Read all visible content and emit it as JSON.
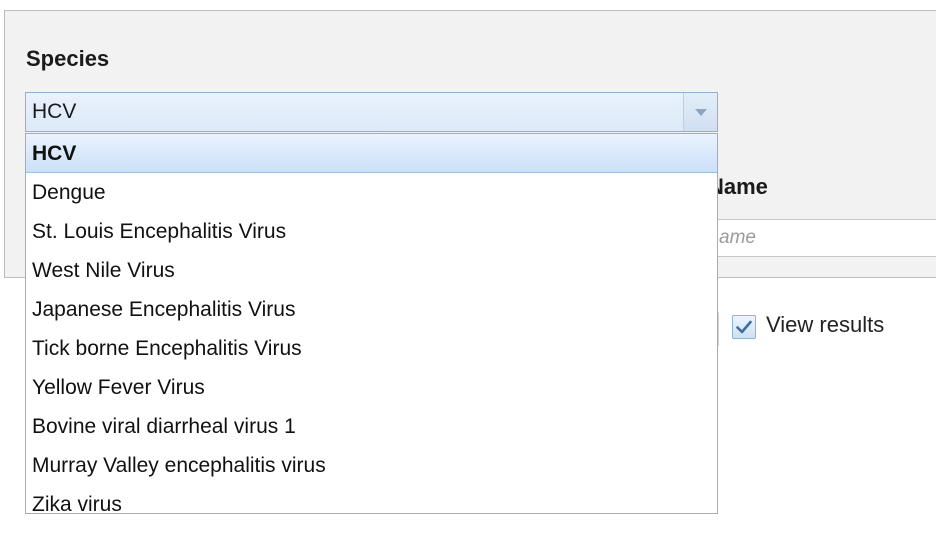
{
  "form": {
    "species_label": "Species",
    "species_selected": "HCV",
    "name_label": "Name",
    "name_placeholder": "ame",
    "view_results_label": "View results",
    "view_results_checked": true
  },
  "dropdown": {
    "options": [
      "HCV",
      "Dengue",
      "St. Louis Encephalitis Virus",
      "West Nile Virus",
      "Japanese Encephalitis Virus",
      "Tick borne Encephalitis Virus",
      "Yellow Fever Virus",
      "Bovine viral diarrheal virus 1",
      "Murray Valley encephalitis virus",
      "Zika virus"
    ],
    "selected_index": 0
  },
  "icons": {
    "combo_trigger": "chevron-down-icon",
    "checkbox": "checkmark-icon"
  },
  "colors": {
    "accent_border": "#8db2d6",
    "selected_bg": "#cbe0f8",
    "check_color": "#3b6ea5",
    "arrow_color": "#8aa6c4"
  }
}
